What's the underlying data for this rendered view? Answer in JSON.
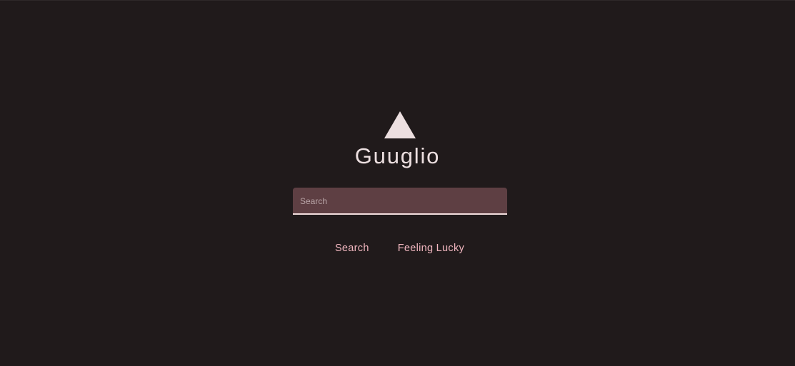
{
  "brand": {
    "name": "Guuglio",
    "logo_icon": "triangle-icon",
    "logo_color": "#ecdfe0"
  },
  "search": {
    "value": "",
    "placeholder": "Search"
  },
  "actions": {
    "search_label": "Search",
    "lucky_label": "Feeling Lucky"
  },
  "colors": {
    "background": "#201a1b",
    "field_fill": "#5e3f43",
    "accent": "#f2b7c0",
    "text": "#ecdfe0"
  }
}
